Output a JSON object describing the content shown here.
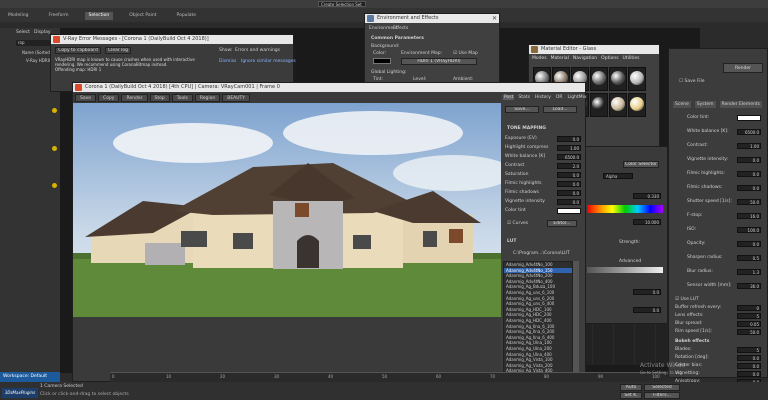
{
  "app": {
    "ribbon_tabs": [
      "Modeling",
      "Freeform",
      "Selection",
      "Object Paint",
      "Populate"
    ],
    "top_search": "Create Selection Set",
    "scene_panel": {
      "tabs": [
        "Select",
        "Display"
      ],
      "filter": "rop",
      "root": "Name (Sorted)",
      "item": "V-Ray HDRI001"
    },
    "workspace": "Workspace: Default",
    "status": {
      "selected": "1 Camera Selected",
      "hint": "Click or click-and-drag to select objects",
      "autokey": "Auto",
      "selected_btn": "Selected",
      "setkey": "Set K.",
      "filters": "Filters..."
    },
    "watermark": {
      "line1": "Activate Windo",
      "line2": "Go to Settings to act"
    }
  },
  "error_dialog": {
    "title": "V-Ray Error Messages - [Corona 1 (DailyBuild Oct 4 2018)]",
    "copy_btn": "Copy to clipboard",
    "clear_btn": "Clear log",
    "filter_label": "Show:",
    "filter_value": "Errors and warnings",
    "msg1": "VRayHDRI map is known to cause crashes when used with interactive rendering. We recommend using CoronaBitmap instead.",
    "msg2": "Offending map: HDRI 1",
    "dismiss": "Dismiss",
    "ignore": "Ignore similar messages"
  },
  "env_dialog": {
    "title": "Environment and Effects",
    "tabs": [
      "Environment",
      "Effects"
    ],
    "section": "Common Parameters",
    "background": "Background:",
    "color": "Color:",
    "env_map": "Environment Map:",
    "use_map": "Use Map",
    "map_name": "HDRI 1 (VRayHDRI)",
    "global_lighting": "Global Lighting:",
    "tint": "Tint:",
    "level": "Level:",
    "ambient": "Ambient:"
  },
  "mat_editor": {
    "title": "Material Editor - Glass",
    "menu": [
      "Modes",
      "Material",
      "Navigation",
      "Options",
      "Utilities"
    ]
  },
  "frame_buffer": {
    "title": "Corona 1 (DailyBuild Oct 4 2018) [4th CPU] | Camera: VRayCam001 | Frame 0",
    "toolbar": [
      "Save",
      "Copy",
      "Render",
      "Stop",
      "Tools",
      "Region",
      "BEAUTY"
    ],
    "right_tabs": [
      "Post",
      "Stats",
      "History",
      "DR",
      "LightMix"
    ],
    "save_btn": "Save...",
    "load_btn": "Load...",
    "tone_header": "TONE MAPPING",
    "tone_rows": [
      {
        "label": "Exposure (EV)",
        "value": "0.0"
      },
      {
        "label": "Highlight compress",
        "value": "1.00"
      },
      {
        "label": "White balance [K]",
        "value": "6500.0"
      },
      {
        "label": "Contrast",
        "value": "2.0"
      },
      {
        "label": "Saturation",
        "value": "0.0"
      },
      {
        "label": "Filmic highlights",
        "value": "0.0"
      },
      {
        "label": "Filmic shadows",
        "value": "0.0"
      },
      {
        "label": "Vignette intensity",
        "value": "0.0"
      },
      {
        "label": "Color tint",
        "value": ""
      }
    ],
    "curves_label": "Curves",
    "curves_editor": "Editor...",
    "lut_header": "LUT",
    "lut_path": "C:\\Program...\\Corona\\LUT",
    "lut_list": [
      "Adanmig_Adv4tNo_100",
      "Adanmig_Adv4tNo_150",
      "Adanmig_Adv4tNo_200",
      "Adanmig_Adv4tNo_400",
      "Adanmig_Ag_Bduza_100",
      "Adanmig_Ag_uns_6_100",
      "Adanmig_Ag_uns_6_200",
      "Adanmig_Ag_uns_6_400",
      "Adanmig_Ag_HDC_100",
      "Adanmig_Ag_HDC_200",
      "Adanmig_Ag_HDC_400",
      "Adanmig_Ag_Ilna_6_100",
      "Adanmig_Ag_Ilna_6_200",
      "Adanmig_Ag_Ilna_6_400",
      "Adanmig_Ag_Ulna_100",
      "Adanmig_Ag_Ulna_200",
      "Adanmig_Ag_Ulna_400",
      "Adanmig_Ag_Vista_100",
      "Adanmig_Ag_Vista_200",
      "Adanmig_Ag_Vista_400",
      "Adanmig_Ca_SC_3313_H"
    ],
    "lut_selected_index": 1
  },
  "mid_panel": {
    "color_selector": "Color Selector",
    "alpha": "Alpha",
    "val1": "0.330",
    "val2": "10.000",
    "advanced": "Advanced",
    "val3": "0.0",
    "val4": "0.0",
    "strength": "Strength:"
  },
  "render_setup": {
    "tabs": [
      "Scene",
      "System",
      "Render Elements"
    ],
    "render_btn": "Render",
    "save_file": "Save File",
    "params": [
      {
        "label": "Color tint:",
        "value": ""
      },
      {
        "label": "White balance [K]:",
        "value": "6500.0"
      },
      {
        "label": "Contrast:",
        "value": "1.00"
      },
      {
        "label": "Vignette intensity:",
        "value": "0.0"
      },
      {
        "label": "Filmic highlights:",
        "value": "0.0"
      },
      {
        "label": "Filmic shadows:",
        "value": "0.0"
      },
      {
        "label": "Shutter speed [1/s]:",
        "value": "50.0"
      },
      {
        "label": "F-stop:",
        "value": "16.0"
      },
      {
        "label": "ISO:",
        "value": "100.0"
      },
      {
        "label": "Opacity:",
        "value": "0.0"
      },
      {
        "label": "Sharpen radius:",
        "value": "0.5"
      },
      {
        "label": "Blur radius:",
        "value": "1.3"
      },
      {
        "label": "Sensor width [mm]:",
        "value": "36.0"
      }
    ],
    "lut_label": "Use LUT",
    "bottom_rows": [
      {
        "label": "Buffer refresh every:",
        "value": "0"
      },
      {
        "label": "Lens effects:",
        "value": "5"
      },
      {
        "label": "Blur spread:",
        "value": "0.05"
      },
      {
        "label": "Rim speed [1/s]:",
        "value": "50.0"
      }
    ],
    "bokeh_header": "Bokeh effects",
    "bokeh_rows": [
      {
        "label": "Blades:",
        "value": "5"
      },
      {
        "label": "Rotation [deg]:",
        "value": "0.0"
      },
      {
        "label": "Center bias:",
        "value": "0.0"
      },
      {
        "label": "Vignetting:",
        "value": "0.0"
      },
      {
        "label": "Anisotropy:",
        "value": "0.0"
      }
    ]
  },
  "timeline": {
    "ticks": [
      "0",
      "10",
      "20",
      "30",
      "40",
      "50",
      "60",
      "70",
      "80",
      "90",
      "100"
    ],
    "frame": "0 / 100"
  },
  "logo": "3DsMaxPlugins"
}
